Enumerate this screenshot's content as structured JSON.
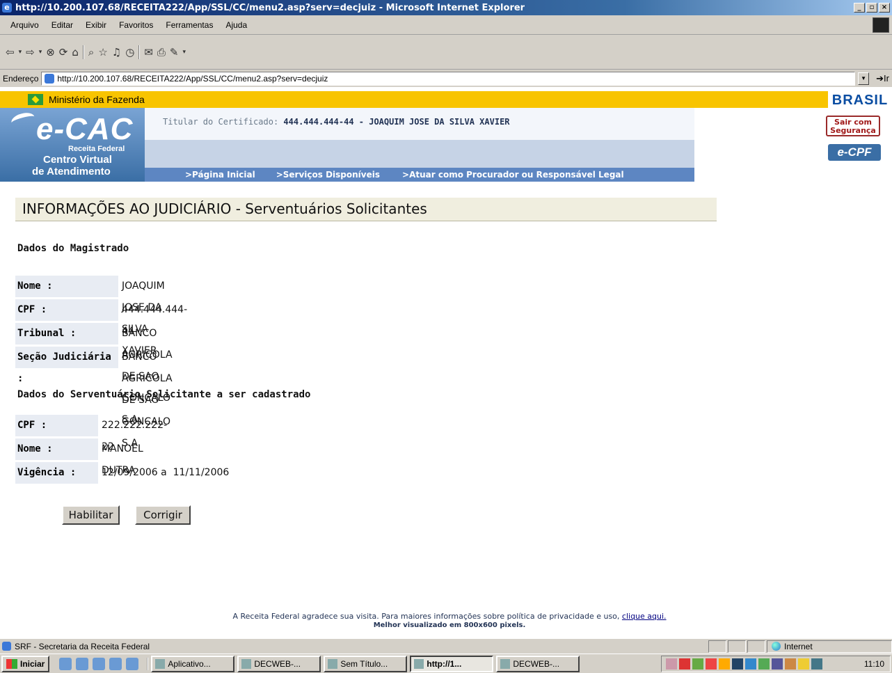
{
  "window": {
    "title": "http://10.200.107.68/RECEITA222/App/SSL/CC/menu2.asp?serv=decjuiz - Microsoft Internet Explorer",
    "min": "_",
    "max": "ÿ",
    "close": "×"
  },
  "menu": [
    "Arquivo",
    "Editar",
    "Exibir",
    "Favoritos",
    "Ferramentas",
    "Ajuda"
  ],
  "address": {
    "label": "Endereço",
    "url": "http://10.200.107.68/RECEITA222/App/SSL/CC/menu2.asp?serv=decjuiz",
    "go": "Ir"
  },
  "header": {
    "ministerio": "Ministério da Fazenda",
    "brasil": "BRASIL",
    "logo": "e-CAC",
    "receita": "Receita Federal",
    "cv_line1": "Centro Virtual",
    "cv_line2": "de Atendimento",
    "cert_label": "Titular do Certificado:",
    "cert_value": "444.444.444-44 - JOAQUIM JOSE DA SILVA XAVIER",
    "nav": [
      ">Página Inicial",
      ">Serviços Disponíveis",
      ">Atuar como Procurador ou Responsável Legal"
    ],
    "sair": "Sair com Segurança",
    "ecpf": "e-CPF"
  },
  "page": {
    "title": "INFORMAÇÕES AO JUDICIÁRIO - Serventuários Solicitantes",
    "magistrado_heading": "Dados do Magistrado",
    "magistrado": [
      {
        "label": "Nome :",
        "value": "JOAQUIM JOSE DA SILVA XAVIER"
      },
      {
        "label": "CPF :",
        "value": "444.444.444-44"
      },
      {
        "label": "Tribunal :",
        "value": "BANCO AGRICOLA DE SAO GONCALO S.A"
      },
      {
        "label": "Seção Judiciária :",
        "value": "BANCO AGRICOLA DE SAO GONCALO S.A"
      }
    ],
    "serventuario_heading": "Dados do Serventuário Solicitante a ser cadastrado",
    "serventuario": [
      {
        "label": "CPF :",
        "value": "222.222.222-22"
      },
      {
        "label": "Nome :",
        "value": "MANOEL DUTRA"
      },
      {
        "label": "Vigência :",
        "value": "12/09/2006 a  11/11/2006"
      }
    ],
    "btn_habilitar": "Habilitar",
    "btn_corrigir": "Corrigir"
  },
  "footer": {
    "text": "A Receita Federal agradece sua visita. Para maiores informações sobre política de privacidade e uso,",
    "link": "clique aqui.",
    "resolution": "Melhor visualizado em 800x600 pixels."
  },
  "status": {
    "text": "SRF - Secretaria da Receita Federal",
    "zone": "Internet"
  },
  "taskbar": {
    "start": "Iniciar",
    "tasks": [
      "Aplicativo...",
      "DECWEB-...",
      "Sem Título...",
      "http://1...",
      "DECWEB-..."
    ],
    "clock": "11:10"
  }
}
